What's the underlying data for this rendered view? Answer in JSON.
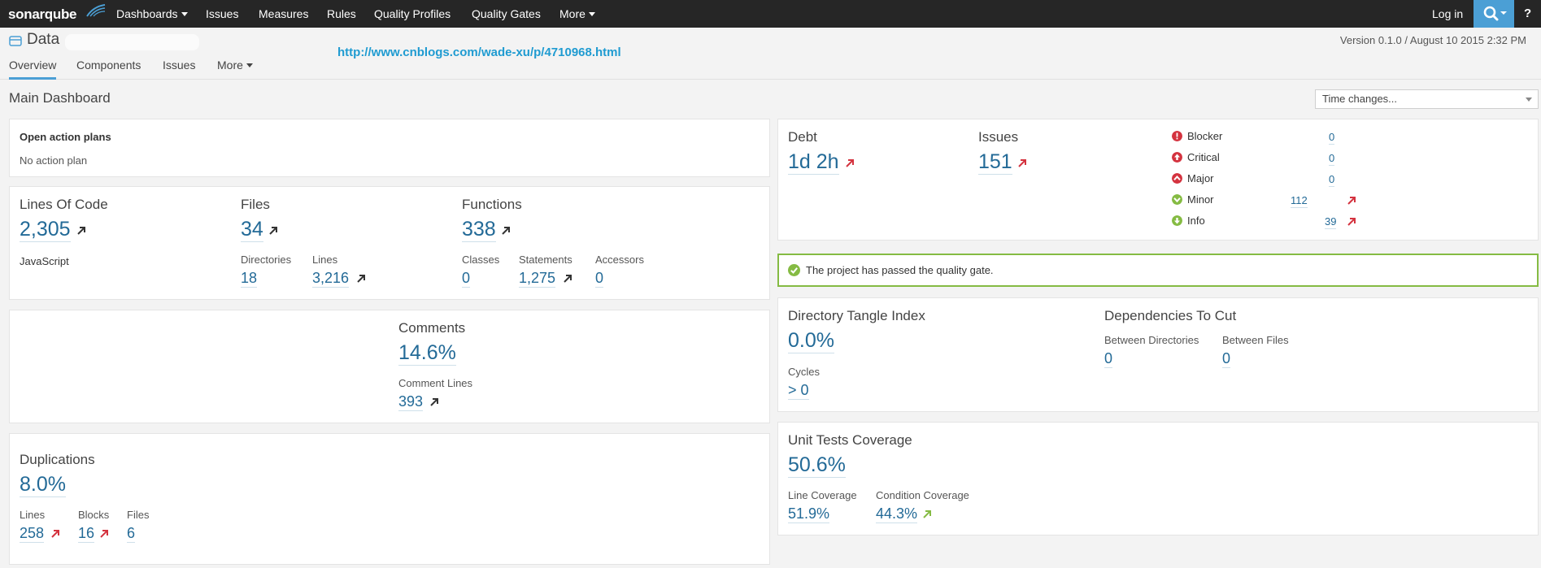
{
  "topnav": {
    "logo_prefix": "sonar",
    "logo_suffix": "qube",
    "items": [
      {
        "label": "Dashboards",
        "caret": true
      },
      {
        "label": "Issues",
        "caret": false
      },
      {
        "label": "Measures",
        "caret": false
      },
      {
        "label": "Rules",
        "caret": false
      },
      {
        "label": "Quality Profiles",
        "caret": false
      },
      {
        "label": "Quality Gates",
        "caret": false
      },
      {
        "label": "More",
        "caret": true
      }
    ],
    "login": "Log in",
    "help": "?",
    "search_icon": "search-icon",
    "accent": "#4b9fd5"
  },
  "header": {
    "project": "Data",
    "url": "http://www.cnblogs.com/wade-xu/p/4710968.html",
    "version": "Version 0.1.0 / August 10 2015 2:32 PM",
    "tabs": [
      "Overview",
      "Components",
      "Issues",
      "More"
    ]
  },
  "dashboard": {
    "title": "Main Dashboard",
    "time_changes": "Time changes..."
  },
  "action_plans": {
    "title": "Open action plans",
    "empty": "No action plan"
  },
  "size": {
    "loc_label": "Lines Of Code",
    "loc_value": "2,305",
    "language": "JavaScript",
    "files_label": "Files",
    "files_value": "34",
    "directories_label": "Directories",
    "directories_value": "18",
    "lines_label": "Lines",
    "lines_value": "3,216",
    "functions_label": "Functions",
    "functions_value": "338",
    "classes_label": "Classes",
    "classes_value": "0",
    "statements_label": "Statements",
    "statements_value": "1,275",
    "accessors_label": "Accessors",
    "accessors_value": "0"
  },
  "comments": {
    "label": "Comments",
    "value": "14.6%",
    "lines_label": "Comment Lines",
    "lines_value": "393"
  },
  "duplications": {
    "label": "Duplications",
    "value": "8.0%",
    "lines_label": "Lines",
    "lines_value": "258",
    "blocks_label": "Blocks",
    "blocks_value": "16",
    "files_label": "Files",
    "files_value": "6"
  },
  "issues": {
    "debt_label": "Debt",
    "debt_value": "1d 2h",
    "issues_label": "Issues",
    "issues_value": "151",
    "severities": [
      {
        "name": "Blocker",
        "value": "0",
        "icon": "blocker-icon",
        "color": "#d4333f"
      },
      {
        "name": "Critical",
        "value": "0",
        "icon": "critical-icon",
        "color": "#d4333f"
      },
      {
        "name": "Major",
        "value": "0",
        "icon": "major-icon",
        "color": "#d4333f"
      },
      {
        "name": "Minor",
        "value": "112",
        "icon": "minor-icon",
        "color": "#85bb43"
      },
      {
        "name": "Info",
        "value": "39",
        "icon": "info-icon",
        "color": "#85bb43"
      }
    ]
  },
  "quality_gate": {
    "message": "The project has passed the quality gate.",
    "color": "#85bb43"
  },
  "design": {
    "tangle_label": "Directory Tangle Index",
    "tangle_value": "0.0%",
    "cycles_label": "Cycles",
    "cycles_value": "> 0",
    "deps_label": "Dependencies To Cut",
    "between_dirs_label": "Between Directories",
    "between_dirs_value": "0",
    "between_files_label": "Between Files",
    "between_files_value": "0"
  },
  "coverage": {
    "label": "Unit Tests Coverage",
    "value": "50.6%",
    "line_label": "Line Coverage",
    "line_value": "51.9%",
    "condition_label": "Condition Coverage",
    "condition_value": "44.3%"
  }
}
